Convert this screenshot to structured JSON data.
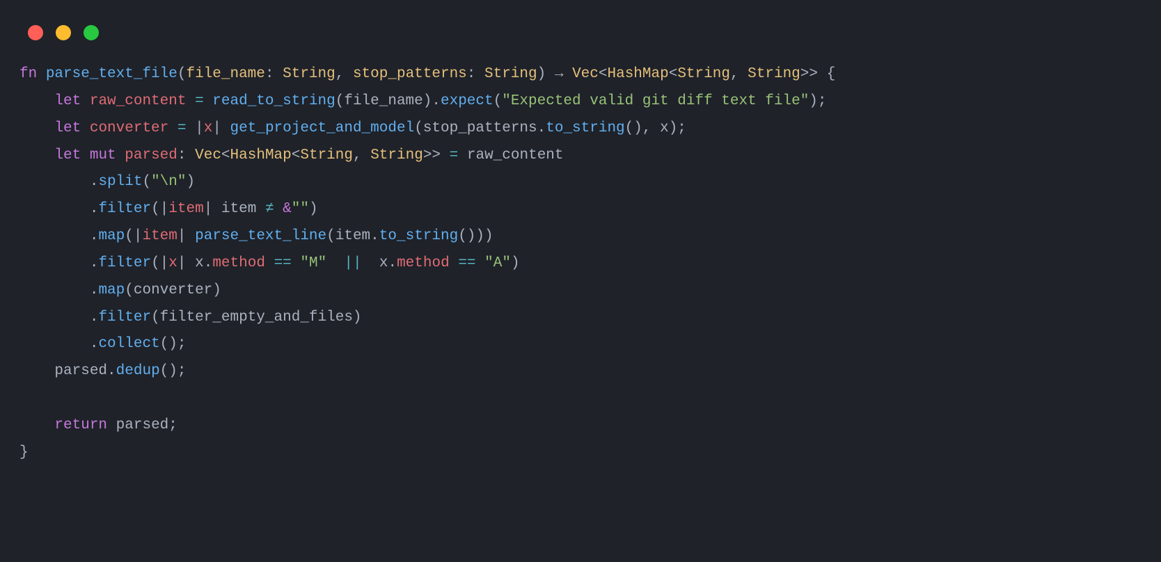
{
  "window": {
    "traffic_lights": [
      "close",
      "minimize",
      "zoom"
    ]
  },
  "code": {
    "language": "rust",
    "tokens": {
      "l1": {
        "fn": "fn",
        "name": "parse_text_file",
        "lp": "(",
        "p1": "file_name",
        "colon1": ":",
        "t1": "String",
        "comma1": ",",
        "p2": "stop_patterns",
        "colon2": ":",
        "t2": "String",
        "rp": ")",
        "arrow": "→",
        "rt_vec": "Vec",
        "lt1": "<",
        "rt_hm": "HashMap",
        "lt2": "<",
        "rt_s1": "String",
        "comma2": ",",
        "rt_s2": "String",
        "gt2": ">>",
        "lb": "{"
      },
      "l2": {
        "let": "let",
        "var": "raw_content",
        "eq": "=",
        "fn1": "read_to_string",
        "lp1": "(",
        "arg1": "file_name",
        "rp1": ")",
        "dot": ".",
        "fn2": "expect",
        "lp2": "(",
        "str": "\"Expected valid git diff text file\"",
        "rp2": ");"
      },
      "l3": {
        "let": "let",
        "var": "converter",
        "eq": "=",
        "pipe1": "|",
        "x": "x",
        "pipe2": "|",
        "fn": "get_project_and_model",
        "lp": "(",
        "arg1": "stop_patterns",
        "dot": ".",
        "fn2": "to_string",
        "lp2": "()",
        "comma": ",",
        "arg2": "x",
        "rp": ");"
      },
      "l4": {
        "let": "let",
        "mut": "mut",
        "var": "parsed",
        "colon": ":",
        "vec": "Vec",
        "lt1": "<",
        "hm": "HashMap",
        "lt2": "<",
        "s1": "String",
        "comma": ",",
        "s2": "String",
        "gt": ">>",
        "eq": "=",
        "rc": "raw_content"
      },
      "l5": {
        "dot": ".",
        "fn": "split",
        "lp": "(",
        "str": "\"\\n\"",
        "rp": ")"
      },
      "l6": {
        "dot": ".",
        "fn": "filter",
        "lp": "(",
        "pipe1": "|",
        "item": "item",
        "pipe2": "|",
        "item2": "item",
        "neq": "≠",
        "amp": "&",
        "str": "\"\"",
        "rp": ")"
      },
      "l7": {
        "dot": ".",
        "fn": "map",
        "lp": "(",
        "pipe1": "|",
        "item": "item",
        "pipe2": "|",
        "fn2": "parse_text_line",
        "lp2": "(",
        "item2": "item",
        "dot2": ".",
        "fn3": "to_string",
        "lp3": "())",
        "rp": ")"
      },
      "l8": {
        "dot": ".",
        "fn": "filter",
        "lp": "(",
        "pipe1": "|",
        "x": "x",
        "pipe2": "|",
        "x2": "x",
        "dot2": ".",
        "prop": "method",
        "eq1": "==",
        "str1": "\"M\"",
        "or": "||",
        "x3": "x",
        "dot3": ".",
        "prop2": "method",
        "eq2": "==",
        "str2": "\"A\"",
        "rp": ")"
      },
      "l9": {
        "dot": ".",
        "fn": "map",
        "lp": "(",
        "arg": "converter",
        "rp": ")"
      },
      "l10": {
        "dot": ".",
        "fn": "filter",
        "lp": "(",
        "arg": "filter_empty_and_files",
        "rp": ")"
      },
      "l11": {
        "dot": ".",
        "fn": "collect",
        "lp": "();"
      },
      "l12": {
        "var": "parsed",
        "dot": ".",
        "fn": "dedup",
        "lp": "();"
      },
      "l14": {
        "ret": "return",
        "var": "parsed",
        "semi": ";"
      },
      "l15": {
        "rb": "}"
      }
    }
  }
}
